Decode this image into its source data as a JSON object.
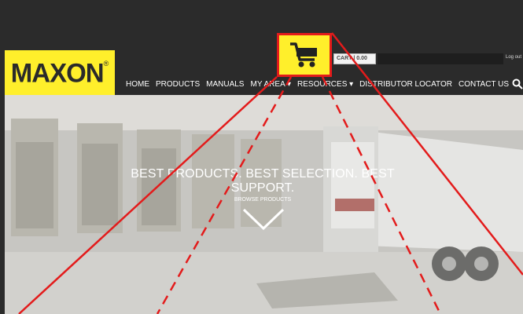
{
  "brand": {
    "logo_text": "MAXON",
    "trademark": "®"
  },
  "cart": {
    "label": "CART | 0.00",
    "icon": "shopping-cart-icon"
  },
  "account": {
    "logout_label": "Log out"
  },
  "nav": {
    "items": [
      "HOME",
      "PRODUCTS",
      "MANUALS",
      "MY AREA ▾",
      "RESOURCES ▾",
      "DISTRIBUTOR LOCATOR",
      "CONTACT US"
    ],
    "search_icon": "search-icon"
  },
  "hero": {
    "tagline": "BEST PRODUCTS. BEST SELECTION. BEST SUPPORT.",
    "browse_label": "BROWSE PRODUCTS",
    "chevron_icon": "chevron-down-icon"
  },
  "colors": {
    "brand_yellow": "#ffef2b",
    "highlight_red": "#e31b1b",
    "header_bg": "#2b2b2b"
  }
}
